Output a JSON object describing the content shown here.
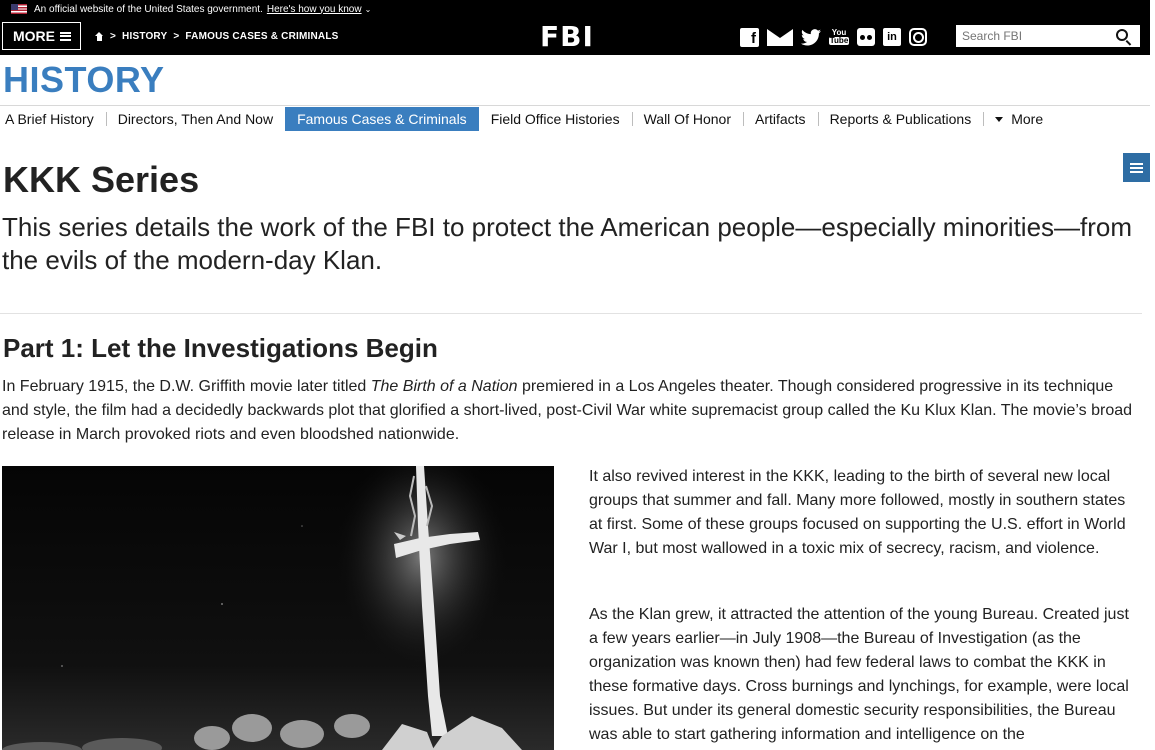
{
  "gov_banner": {
    "text": "An official website of the United States government.",
    "link": "Here's how you know"
  },
  "topnav": {
    "more_label": "MORE",
    "breadcrumb": [
      "HISTORY",
      "FAMOUS CASES & CRIMINALS"
    ],
    "logo": "FBI",
    "social_icons": [
      "facebook-icon",
      "mail-icon",
      "twitter-icon",
      "youtube-icon",
      "flickr-icon",
      "linkedin-icon",
      "instagram-icon"
    ],
    "search_placeholder": "Search FBI"
  },
  "section": {
    "title": "HISTORY"
  },
  "subnav": {
    "items": [
      "A Brief History",
      "Directors, Then And Now",
      "Famous Cases & Criminals",
      "Field Office Histories",
      "Wall Of Honor",
      "Artifacts",
      "Reports & Publications"
    ],
    "more_label": "More",
    "active": "Famous Cases & Criminals"
  },
  "article": {
    "title": "KKK Series",
    "lede": "This series details the work of the FBI to protect the American people—especially minorities—from the evils of the modern-day Klan.",
    "part_title": "Part 1: Let the Investigations Begin",
    "p1_before": "In February 1915, the D.W. Griffith movie later titled ",
    "p1_italic": "The Birth of a Nation",
    "p1_after": " premiered in a Los Angeles theater. Though considered progressive in its technique and style, the film had a decidedly backwards plot that glorified a short-lived, post-Civil War white supremacist group called the Ku Klux Klan. The movie’s broad release in March provoked riots and even bloodshed nationwide.",
    "p2": "It also revived interest in the KKK, leading to the birth of several new local groups that summer and fall. Many more followed, mostly in southern states at first. Some of these groups focused on supporting the U.S. effort in World War I, but most wallowed in a toxic mix of secrecy, racism, and violence.",
    "p3": "As the Klan grew, it attracted the attention of the young Bureau. Created just a few years earlier—in July 1908—the Bureau of Investigation (as the organization was known then) had few federal laws to combat the KKK in these formative days. Cross burnings and lynchings, for example, were local issues. But under its general domestic security responsibilities, the Bureau was able to start gathering information and intelligence on the"
  },
  "colors": {
    "accent": "#3a7ebf",
    "banner_bg": "#000000",
    "text": "#222222"
  }
}
